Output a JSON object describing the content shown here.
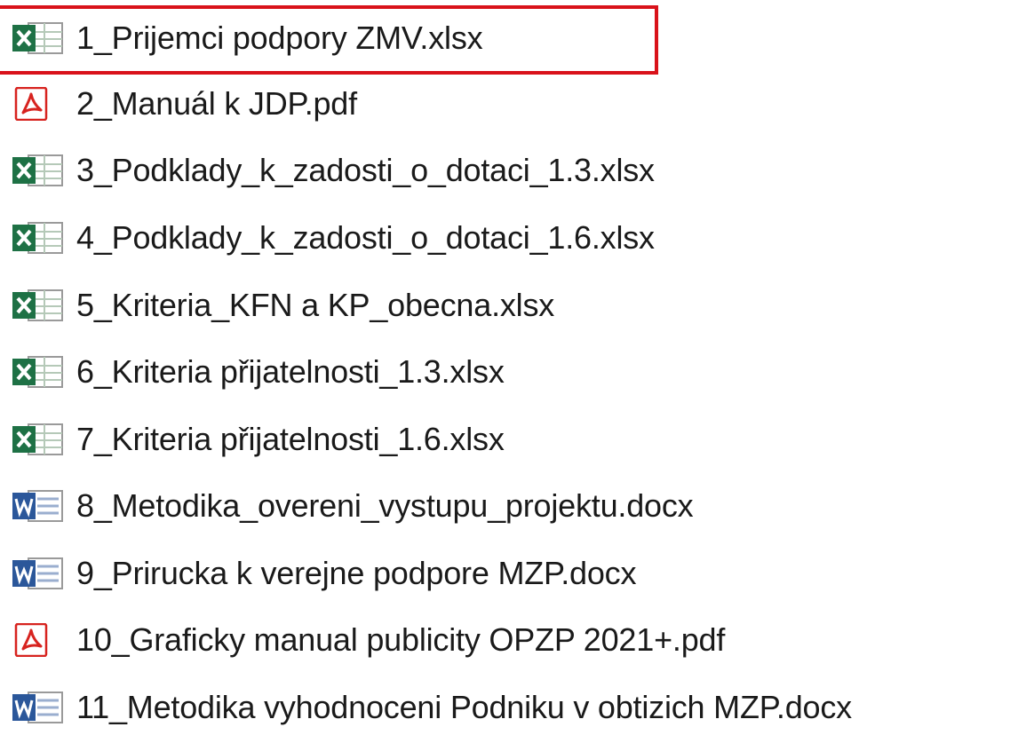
{
  "files": [
    {
      "name": "1_Prijemci podpory ZMV.xlsx",
      "type": "excel",
      "icon": "excel-file-icon",
      "selected": true
    },
    {
      "name": "2_Manuál k JDP.pdf",
      "type": "pdf",
      "icon": "pdf-file-icon",
      "selected": false
    },
    {
      "name": "3_Podklady_k_zadosti_o_dotaci_1.3.xlsx",
      "type": "excel",
      "icon": "excel-file-icon",
      "selected": false
    },
    {
      "name": "4_Podklady_k_zadosti_o_dotaci_1.6.xlsx",
      "type": "excel",
      "icon": "excel-file-icon",
      "selected": false
    },
    {
      "name": "5_Kriteria_KFN a KP_obecna.xlsx",
      "type": "excel",
      "icon": "excel-file-icon",
      "selected": false
    },
    {
      "name": "6_Kriteria přijatelnosti_1.3.xlsx",
      "type": "excel",
      "icon": "excel-file-icon",
      "selected": false
    },
    {
      "name": "7_Kriteria přijatelnosti_1.6.xlsx",
      "type": "excel",
      "icon": "excel-file-icon",
      "selected": false
    },
    {
      "name": "8_Metodika_overeni_vystupu_projektu.docx",
      "type": "word",
      "icon": "word-file-icon",
      "selected": false
    },
    {
      "name": "9_Prirucka k verejne podpore MZP.docx",
      "type": "word",
      "icon": "word-file-icon",
      "selected": false
    },
    {
      "name": "10_Graficky manual publicity OPZP 2021+.pdf",
      "type": "pdf",
      "icon": "pdf-file-icon",
      "selected": false
    },
    {
      "name": "11_Metodika vyhodnoceni Podniku v obtizich MZP.docx",
      "type": "word",
      "icon": "word-file-icon",
      "selected": false
    }
  ],
  "colors": {
    "excel": "#1e7145",
    "word": "#2b579a",
    "pdf": "#d7231f",
    "selection_outline": "#d9121a"
  }
}
